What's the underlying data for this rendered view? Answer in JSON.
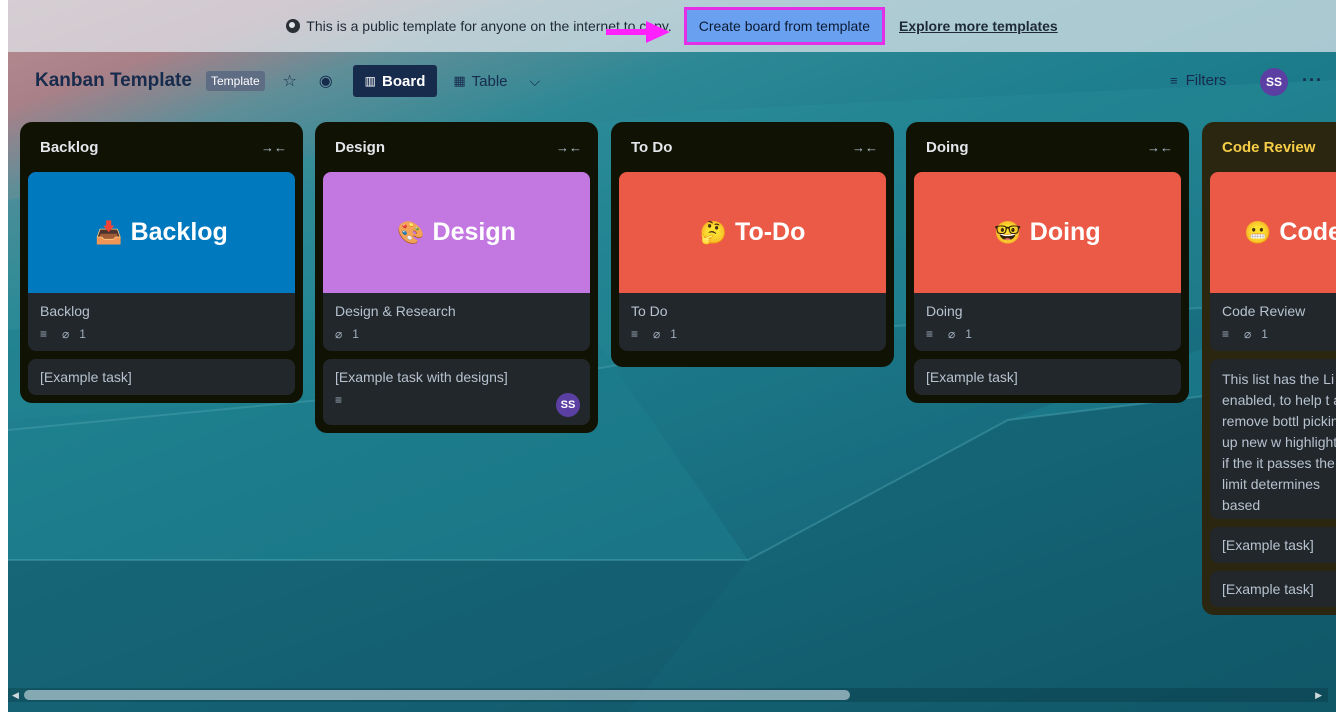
{
  "banner": {
    "text": "This is a public template for anyone on the internet to copy.",
    "create_button": "Create board from template",
    "explore_link": "Explore more templates"
  },
  "header": {
    "title": "Kanban Template",
    "badge": "Template",
    "board_view": "Board",
    "table_view": "Table",
    "filters": "Filters",
    "avatar": "SS",
    "more": "···"
  },
  "lists": [
    {
      "title": "Backlog",
      "collapse": "→←",
      "cover_text": "Backlog",
      "cover_emoji": "📥",
      "cover_color": "#0079bf",
      "card_title": "Backlog",
      "attachments": "1",
      "extra_cards": [
        "[Example task]"
      ]
    },
    {
      "title": "Design",
      "collapse": "→←",
      "cover_text": "Design",
      "cover_emoji": "🎨",
      "cover_color": "#c377e0",
      "card_title": "Design & Research",
      "attachments": "1",
      "extra_cards": [
        "[Example task with designs]"
      ],
      "extra_avatar": "SS"
    },
    {
      "title": "To Do",
      "collapse": "→←",
      "cover_text": "To-Do",
      "cover_emoji": "🤔",
      "cover_color": "#eb5a46",
      "card_title": "To Do",
      "attachments": "1",
      "extra_cards": []
    },
    {
      "title": "Doing",
      "collapse": "→←",
      "cover_text": "Doing",
      "cover_emoji": "🤓",
      "cover_color": "#eb5a46",
      "card_title": "Doing",
      "attachments": "1",
      "extra_cards": [
        "[Example task]"
      ]
    },
    {
      "title": "Code Review",
      "cover_text": "Code",
      "cover_emoji": "😬",
      "cover_color": "#eb5a46",
      "card_title": "Code Review",
      "attachments": "1",
      "description_card": "This list has the Li enabled, to help t and remove bottl picking up new w highlighted if the it passes the limit determines based",
      "extra_cards": [
        "[Example task]",
        "[Example task]"
      ]
    }
  ],
  "colors": {
    "list_bg": "#101204",
    "card_bg": "#22272b",
    "accent_highlight": "#e52fe6",
    "create_button_bg": "#6aa0f0"
  }
}
